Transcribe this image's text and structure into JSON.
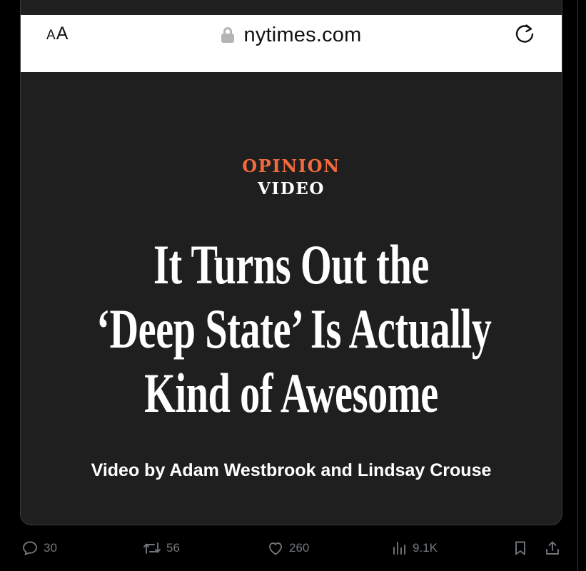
{
  "browser": {
    "text_size_label_small": "A",
    "text_size_label_large": "A",
    "url": "nytimes.com"
  },
  "article": {
    "section": "OPINION",
    "content_type": "VIDEO",
    "headline_lines": [
      "It Turns Out the",
      "‘Deep State’ Is Actually",
      "Kind of Awesome"
    ],
    "byline": "Video by Adam Westbrook and Lindsay Crouse"
  },
  "colors": {
    "page_background": "#000000",
    "card_background": "#1f1f1f",
    "section_accent": "#f26a3d",
    "action_gray": "#71767b"
  },
  "actions": {
    "reply": {
      "icon": "reply-icon",
      "count": "30"
    },
    "repost": {
      "icon": "repost-icon",
      "count": "56"
    },
    "like": {
      "icon": "heart-icon",
      "count": "260"
    },
    "views": {
      "icon": "views-chart-icon",
      "count": "9.1K"
    },
    "bookmark": {
      "icon": "bookmark-icon"
    },
    "share": {
      "icon": "share-icon"
    }
  }
}
